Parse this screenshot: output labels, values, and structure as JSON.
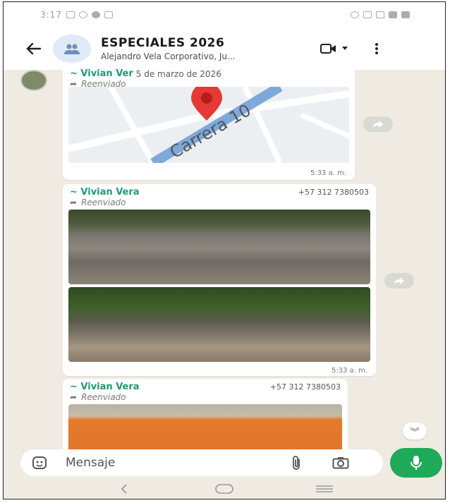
{
  "status_bar": {
    "time": "3:17"
  },
  "header": {
    "title": "ESPECIALES 2026",
    "subtitle": "Alejandro Vela Corporativo, Ju..."
  },
  "messages": [
    {
      "sender": "~ Vivian Ver",
      "date": "5 de marzo de 2026",
      "forwarded": "Reenviado",
      "map_label": "Carrera 10",
      "time": "5:33 a. m."
    },
    {
      "sender": "~ Vivian Vera",
      "phone": "+57 312 7380503",
      "forwarded": "Reenviado",
      "time": "5:33 a. m."
    },
    {
      "sender": "~ Vivian Vera",
      "phone": "+57 312 7380503",
      "forwarded": "Reenviado"
    }
  ],
  "composer": {
    "placeholder": "Mensaje"
  },
  "colors": {
    "accent_green": "#1faa59",
    "sender_name": "#1f9a73",
    "chat_background": "#efeae2",
    "map_pin": "#e53935"
  },
  "icons": {
    "back": "arrow-left-icon",
    "video": "video-camera-icon",
    "menu": "more-vertical-icon",
    "forward": "forward-icon",
    "emoji": "sticker-icon",
    "attach": "paperclip-icon",
    "camera": "camera-icon",
    "mic": "microphone-icon",
    "scroll": "chevron-double-down-icon"
  }
}
